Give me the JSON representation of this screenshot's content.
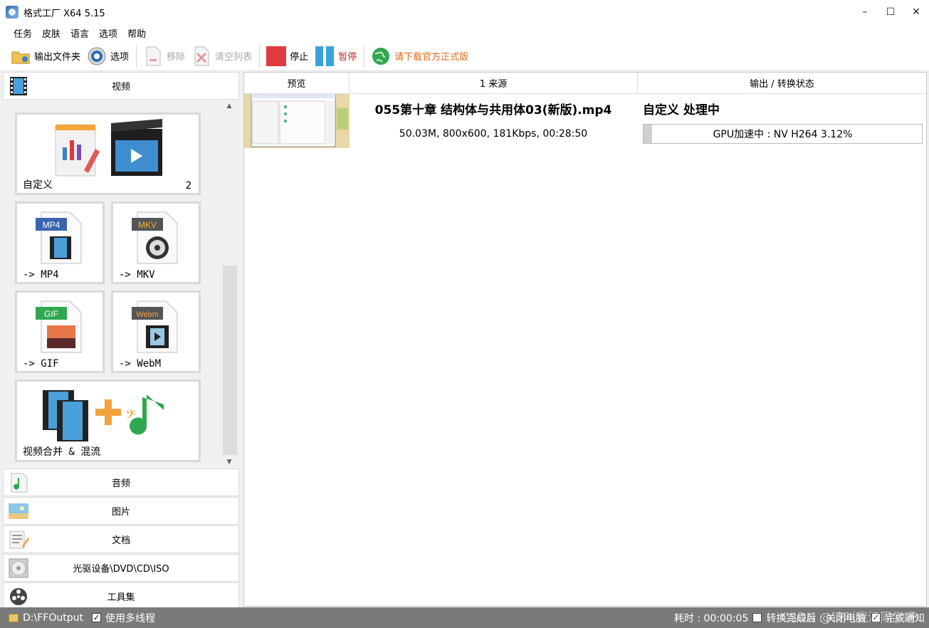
{
  "window": {
    "title": "格式工厂 X64 5.15",
    "minimize": "–",
    "maximize": "☐",
    "close": "✕"
  },
  "menu": [
    "任务",
    "皮肤",
    "语言",
    "选项",
    "帮助"
  ],
  "toolbar": {
    "output_folder": "输出文件夹",
    "options": "选项",
    "remove": "移除",
    "clear_list": "清空列表",
    "stop": "停止",
    "pause": "暂停",
    "download": "请下载官方正式版"
  },
  "categories": {
    "video": "视频",
    "audio": "音频",
    "image": "图片",
    "document": "文档",
    "disc": "光驱设备\\DVD\\CD\\ISO",
    "tools": "工具集"
  },
  "tiles": {
    "custom": {
      "label": "自定义",
      "count": "2"
    },
    "mp4": {
      "label": "-> MP4",
      "badge": "MP4"
    },
    "mkv": {
      "label": "-> MKV",
      "badge": "MKV"
    },
    "gif": {
      "label": "-> GIF",
      "badge": "GIF"
    },
    "webm": {
      "label": "-> WebM",
      "badge": "Webm"
    },
    "merge": {
      "label": "视频合并 & 混流"
    }
  },
  "filelist": {
    "columns": [
      "预览",
      "1 来源",
      "输出 / 转换状态"
    ],
    "rows": [
      {
        "source_name": "055第十章 结构体与共用体03(新版).mp4",
        "source_info": "50.03M, 800x600, 181Kbps, 00:28:50",
        "output_title": "自定义 处理中",
        "progress_text": "GPU加速中 : NV H264 3.12%",
        "progress_fraction": 0.0312
      }
    ]
  },
  "statusbar": {
    "output_path": "D:\\FFOutput",
    "multithread_label": "使用多线程",
    "elapsed": "耗时 : 00:00:05",
    "after_convert": "转换完成后 : 关闭电脑",
    "notify": "完成通知"
  },
  "watermark": "CSDN @请叫我江同学呀"
}
